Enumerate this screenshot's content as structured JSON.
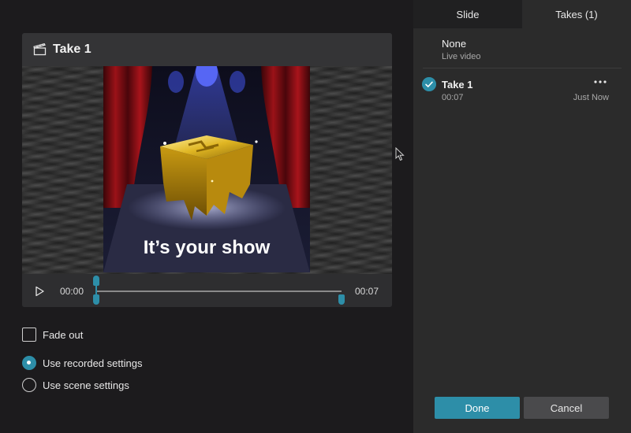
{
  "player": {
    "title": "Take 1",
    "video_caption": "It’s your show",
    "time_start": "00:00",
    "time_end": "00:07"
  },
  "options": {
    "fade_out": {
      "label": "Fade out",
      "checked": false
    },
    "use_recorded": {
      "label": "Use recorded settings",
      "checked": true
    },
    "use_scene": {
      "label": "Use scene settings",
      "checked": false
    }
  },
  "tabs": [
    {
      "label": "Slide",
      "active": false
    },
    {
      "label": "Takes (1)",
      "active": true
    }
  ],
  "takes": {
    "none": {
      "name": "None",
      "sub": "Live video"
    },
    "items": [
      {
        "name": "Take 1",
        "duration": "00:07",
        "when": "Just Now",
        "selected": true
      }
    ]
  },
  "buttons": {
    "done": "Done",
    "cancel": "Cancel"
  },
  "colors": {
    "accent": "#2d8ea8",
    "panel": "#2b2b2b",
    "background": "#1c1b1d"
  },
  "icons": {
    "header": "clapperboard-icon",
    "play": "play-icon",
    "check": "check-icon",
    "more": "more-horizontal-icon"
  }
}
